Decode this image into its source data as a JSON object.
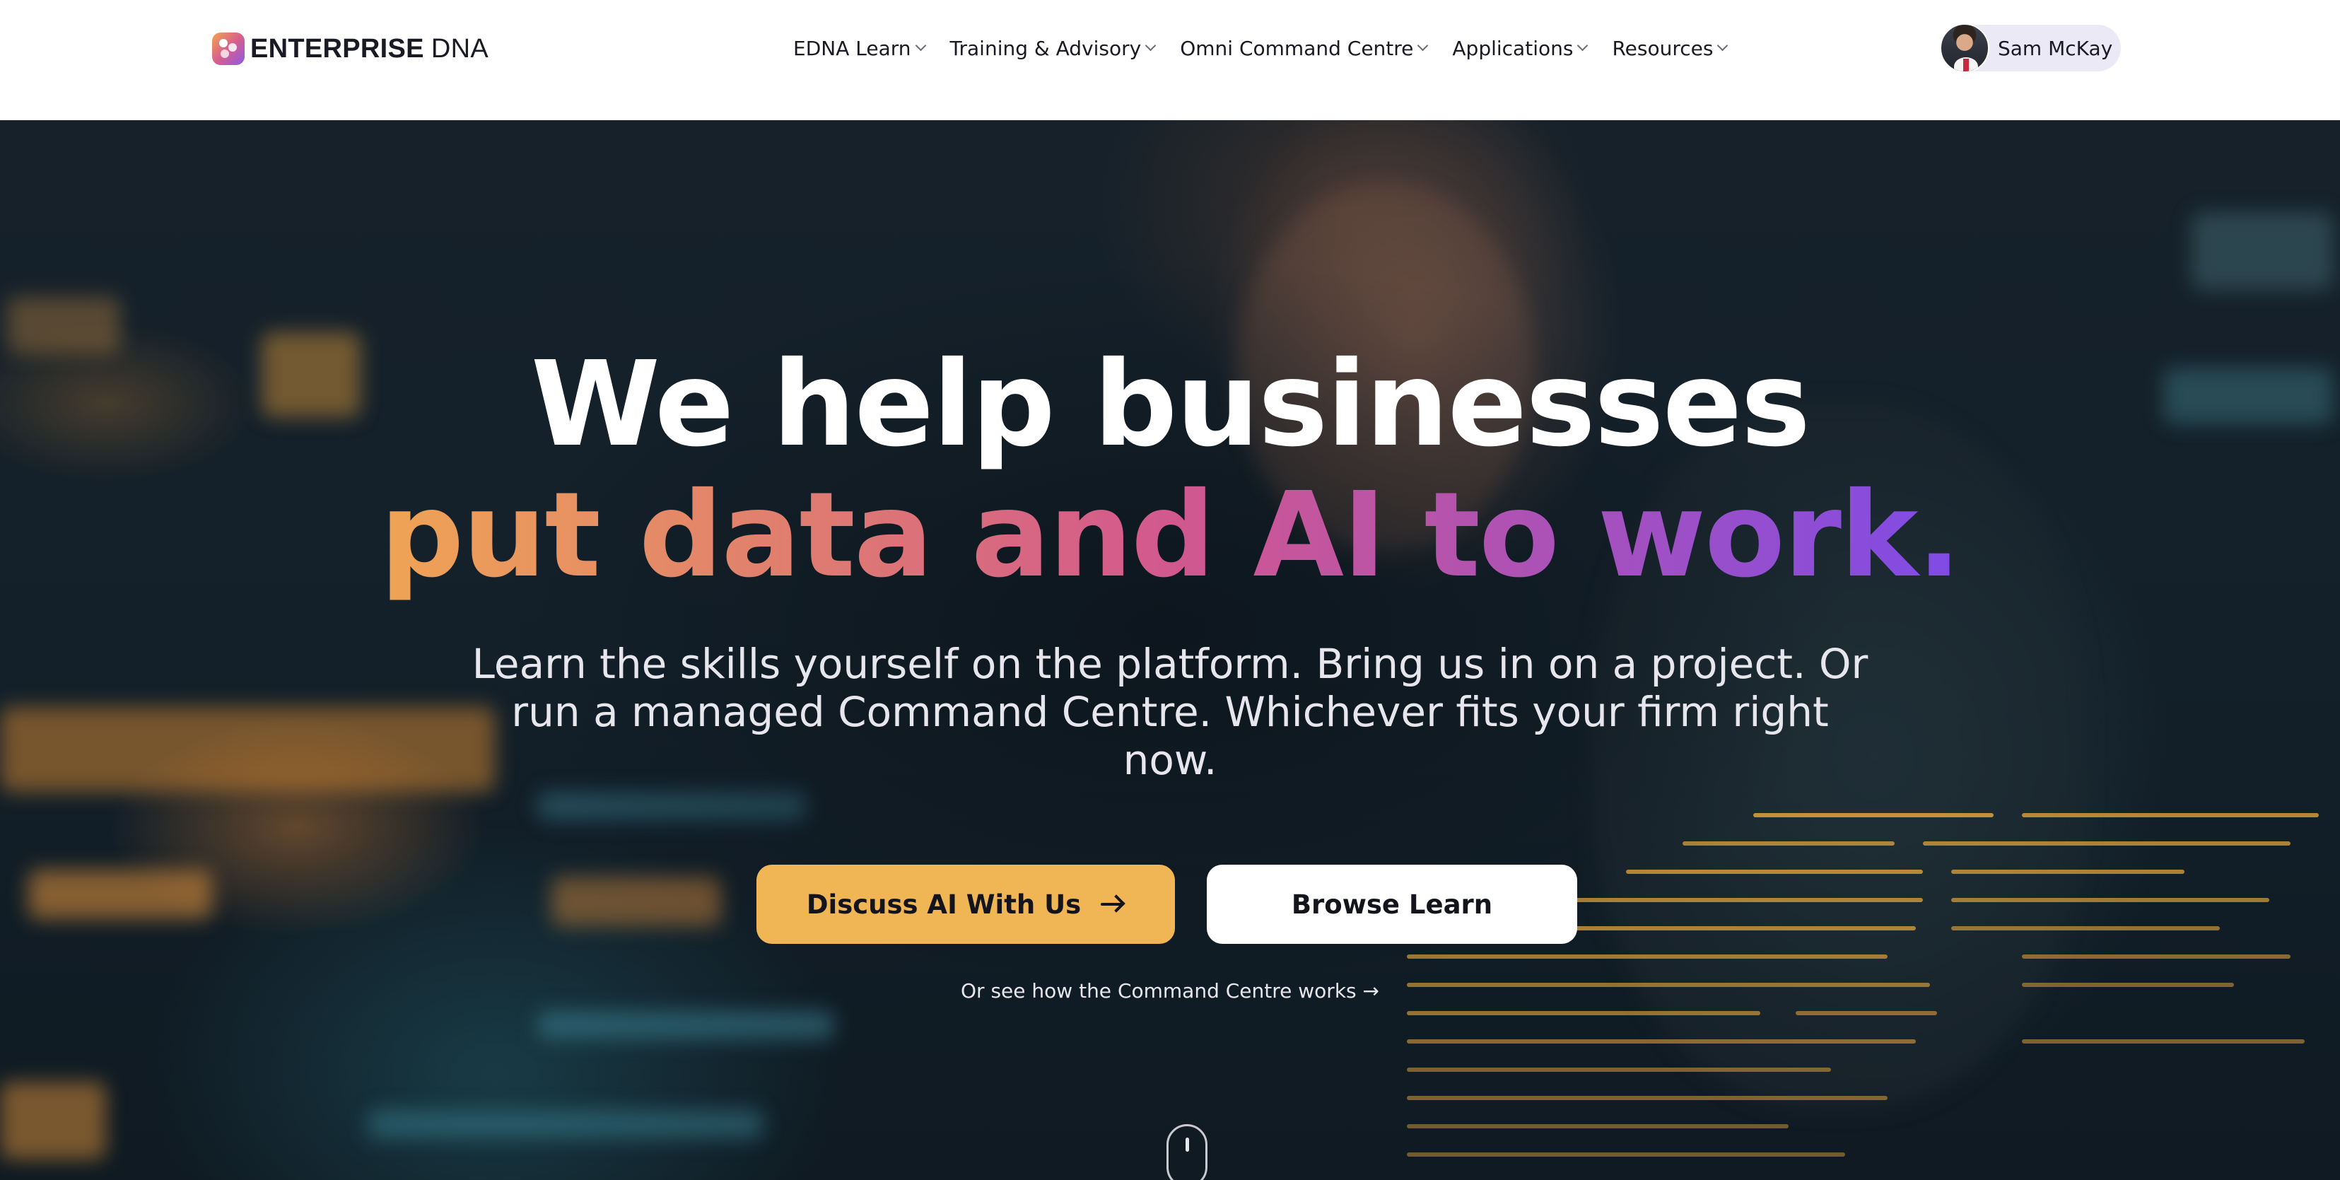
{
  "header": {
    "logo": {
      "bold": "ENTERPRISE",
      "light": "DNA"
    },
    "nav": [
      {
        "label": "EDNA Learn"
      },
      {
        "label": "Training & Advisory"
      },
      {
        "label": "Omni Command Centre"
      },
      {
        "label": "Applications"
      },
      {
        "label": "Resources"
      }
    ],
    "user": {
      "name": "Sam McKay"
    }
  },
  "hero": {
    "headline_line1": "We help businesses",
    "headline_line2": "put data and AI to work.",
    "subheadline": {
      "line1": "Learn the skills yourself on the platform. Bring us in on a project. Or",
      "line2": "run a managed Command Centre. Whichever fits your firm right",
      "line3": "now."
    },
    "primary_button": "Discuss AI With Us",
    "secondary_button": "Browse Learn",
    "secondary_link": "Or see how the Command Centre works →"
  },
  "colors": {
    "accent_button": "#f0b555",
    "gradient_start": "#efa455",
    "gradient_mid": "#d2588e",
    "gradient_end": "#7f4be6",
    "hero_background": "#13202a",
    "user_pill": "#ece9f7"
  },
  "icons": [
    "enterprise-dna-logo-icon",
    "chevron-down-icon",
    "avatar",
    "arrow-right-icon",
    "mouse-scroll-icon"
  ]
}
